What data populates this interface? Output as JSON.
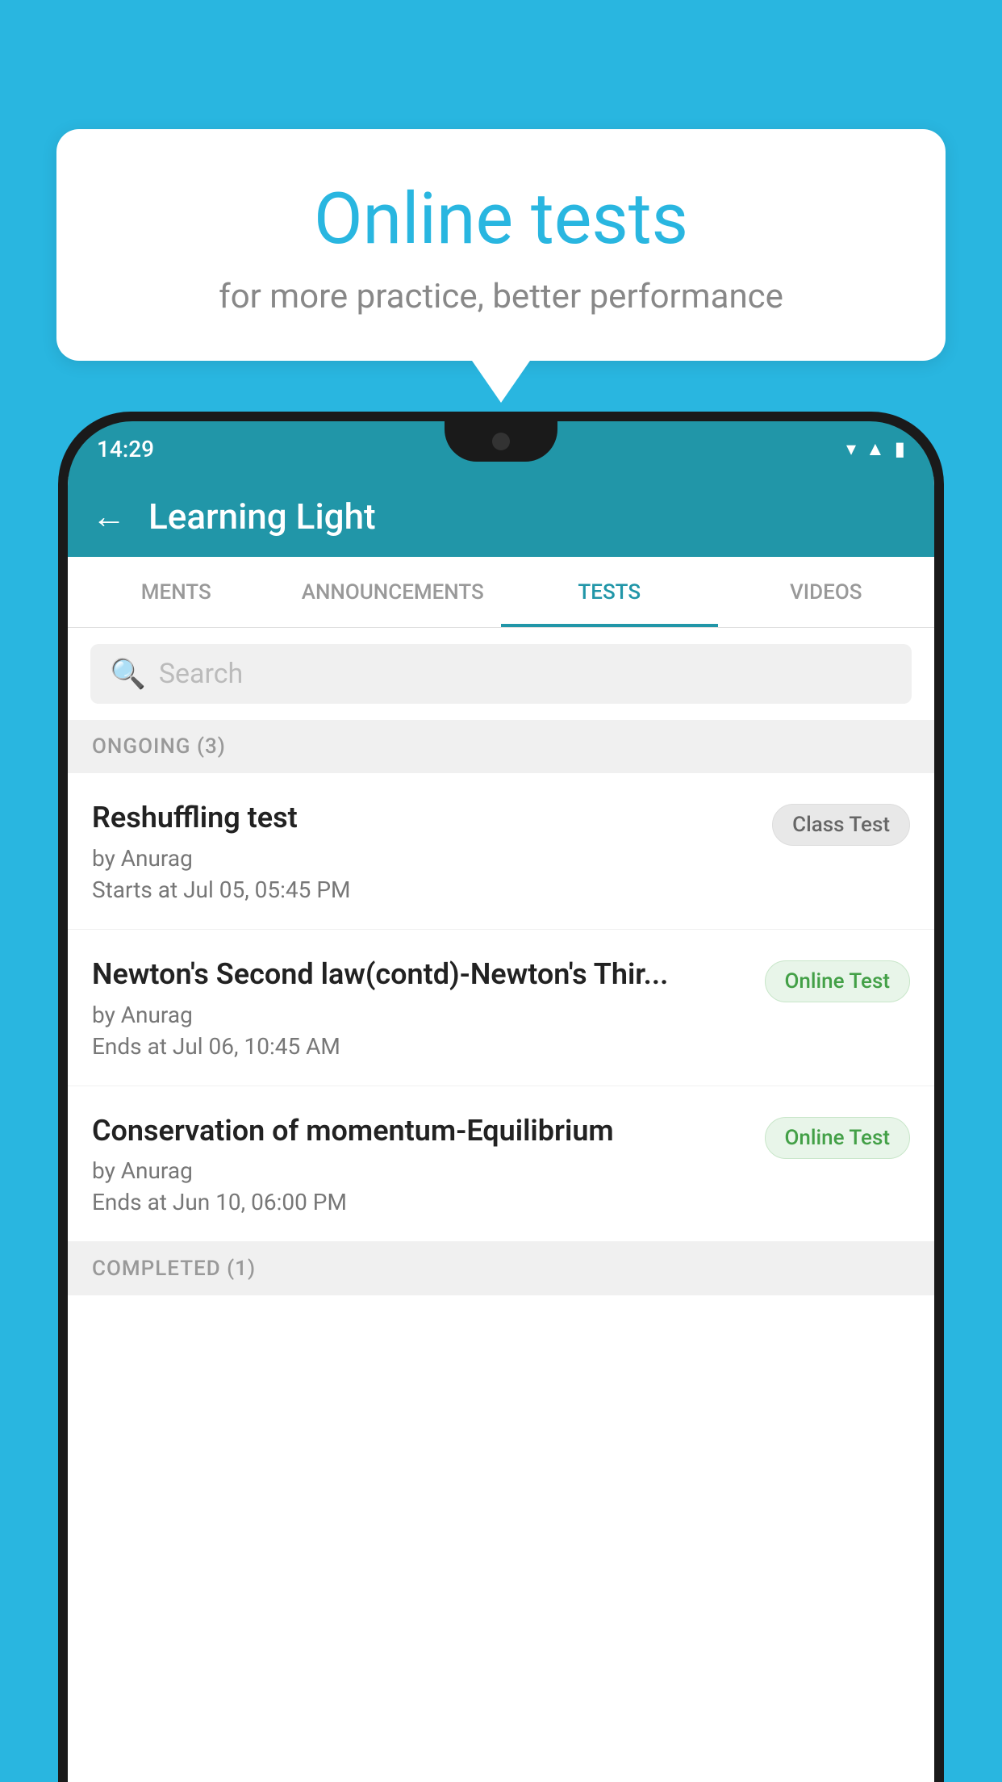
{
  "background": {
    "color": "#29b6e0"
  },
  "speech_bubble": {
    "title": "Online tests",
    "subtitle": "for more practice, better performance"
  },
  "phone": {
    "status_bar": {
      "time": "14:29",
      "icons": [
        "wifi",
        "signal",
        "battery"
      ]
    },
    "app_bar": {
      "title": "Learning Light",
      "back_label": "←"
    },
    "tabs": [
      {
        "label": "MENTS",
        "active": false
      },
      {
        "label": "ANNOUNCEMENTS",
        "active": false
      },
      {
        "label": "TESTS",
        "active": true
      },
      {
        "label": "VIDEOS",
        "active": false
      }
    ],
    "search": {
      "placeholder": "Search"
    },
    "ongoing_section": {
      "header": "ONGOING (3)",
      "items": [
        {
          "name": "Reshuffling test",
          "by": "by Anurag",
          "time": "Starts at  Jul 05, 05:45 PM",
          "badge": "Class Test",
          "badge_type": "class"
        },
        {
          "name": "Newton's Second law(contd)-Newton's Thir...",
          "by": "by Anurag",
          "time": "Ends at  Jul 06, 10:45 AM",
          "badge": "Online Test",
          "badge_type": "online"
        },
        {
          "name": "Conservation of momentum-Equilibrium",
          "by": "by Anurag",
          "time": "Ends at  Jun 10, 06:00 PM",
          "badge": "Online Test",
          "badge_type": "online"
        }
      ]
    },
    "completed_section": {
      "header": "COMPLETED (1)"
    }
  }
}
